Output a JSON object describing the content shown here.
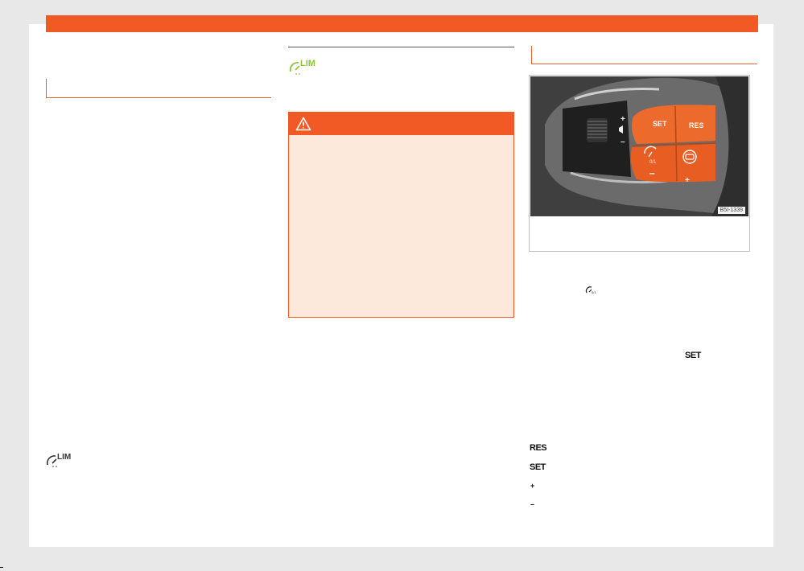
{
  "figure": {
    "code": "B5I-1339",
    "buttons": {
      "set": "SET",
      "res": "RES",
      "minus": "–",
      "plus": "+",
      "volume_plus": "+",
      "volume_minus": "–",
      "onoff": "0/1"
    }
  },
  "inline_keys": {
    "set_inline": "SET",
    "legend_res": "RES",
    "legend_set": "SET",
    "legend_plus": "+",
    "legend_minus": "–"
  },
  "icons": {
    "lim_text": "LIM",
    "lim_color_green": "#8cc63f",
    "lim_color_dark": "#333333",
    "warning": "warning-triangle-icon",
    "limiter_toggle": "speed-limiter-icon"
  },
  "colors": {
    "accent": "#f15a24",
    "warning_bg": "#fde9dc"
  }
}
